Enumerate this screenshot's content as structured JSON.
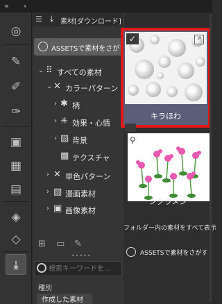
{
  "topbar": {
    "collapse_icon": "double-chevron-left-icon",
    "back_icon": "chevron-left-icon"
  },
  "strip_icons": [
    "material-search-icon",
    "pen-tool-icon",
    "brush-settings-icon",
    "brush-target-icon",
    "layer-panel-icon",
    "palette-grid-icon",
    "film-icon",
    "layer-property-icon",
    "stack-layers-icon",
    "download-material-icon"
  ],
  "tree": {
    "header_title": "素材[ダウンロード]",
    "assets_button": "ASSETSで素材をさがす",
    "items": [
      {
        "label": "すべての素材",
        "indent": 0,
        "arrow": "⌄",
        "icon": "grid-dots-icon"
      },
      {
        "label": "カラーパターン",
        "indent": 1,
        "arrow": "⌄",
        "icon": "color-pattern-icon"
      },
      {
        "label": "柄",
        "indent": 2,
        "arrow": "›",
        "icon": "pattern-icon"
      },
      {
        "label": "効果・心情",
        "indent": 2,
        "arrow": "›",
        "icon": "effect-icon"
      },
      {
        "label": "背景",
        "indent": 2,
        "arrow": "›",
        "icon": "background-icon"
      },
      {
        "label": "テクスチャ",
        "indent": 2,
        "arrow": "",
        "icon": "texture-icon"
      },
      {
        "label": "単色パターン",
        "indent": 1,
        "arrow": "›",
        "icon": "mono-pattern-icon"
      },
      {
        "label": "漫画素材",
        "indent": 1,
        "arrow": "›",
        "icon": "manga-icon"
      },
      {
        "label": "画像素材",
        "indent": 1,
        "arrow": "›",
        "icon": "image-icon"
      }
    ],
    "search_placeholder": "検索キーワードを…",
    "kind_label": "種別",
    "kind_value": "作成した素材"
  },
  "materials": {
    "items": [
      {
        "name": "キラほわ",
        "selected": true
      },
      {
        "name": "シクラメン",
        "selected": false
      }
    ],
    "folder_button": "フォルダー内の素材をすべて表示",
    "assets_button": "ASSETSで素材をさがす"
  },
  "colors": {
    "selection_border": "#e01818",
    "selected_card_bg": "#5a5e78",
    "panel_bg": "#353535"
  }
}
